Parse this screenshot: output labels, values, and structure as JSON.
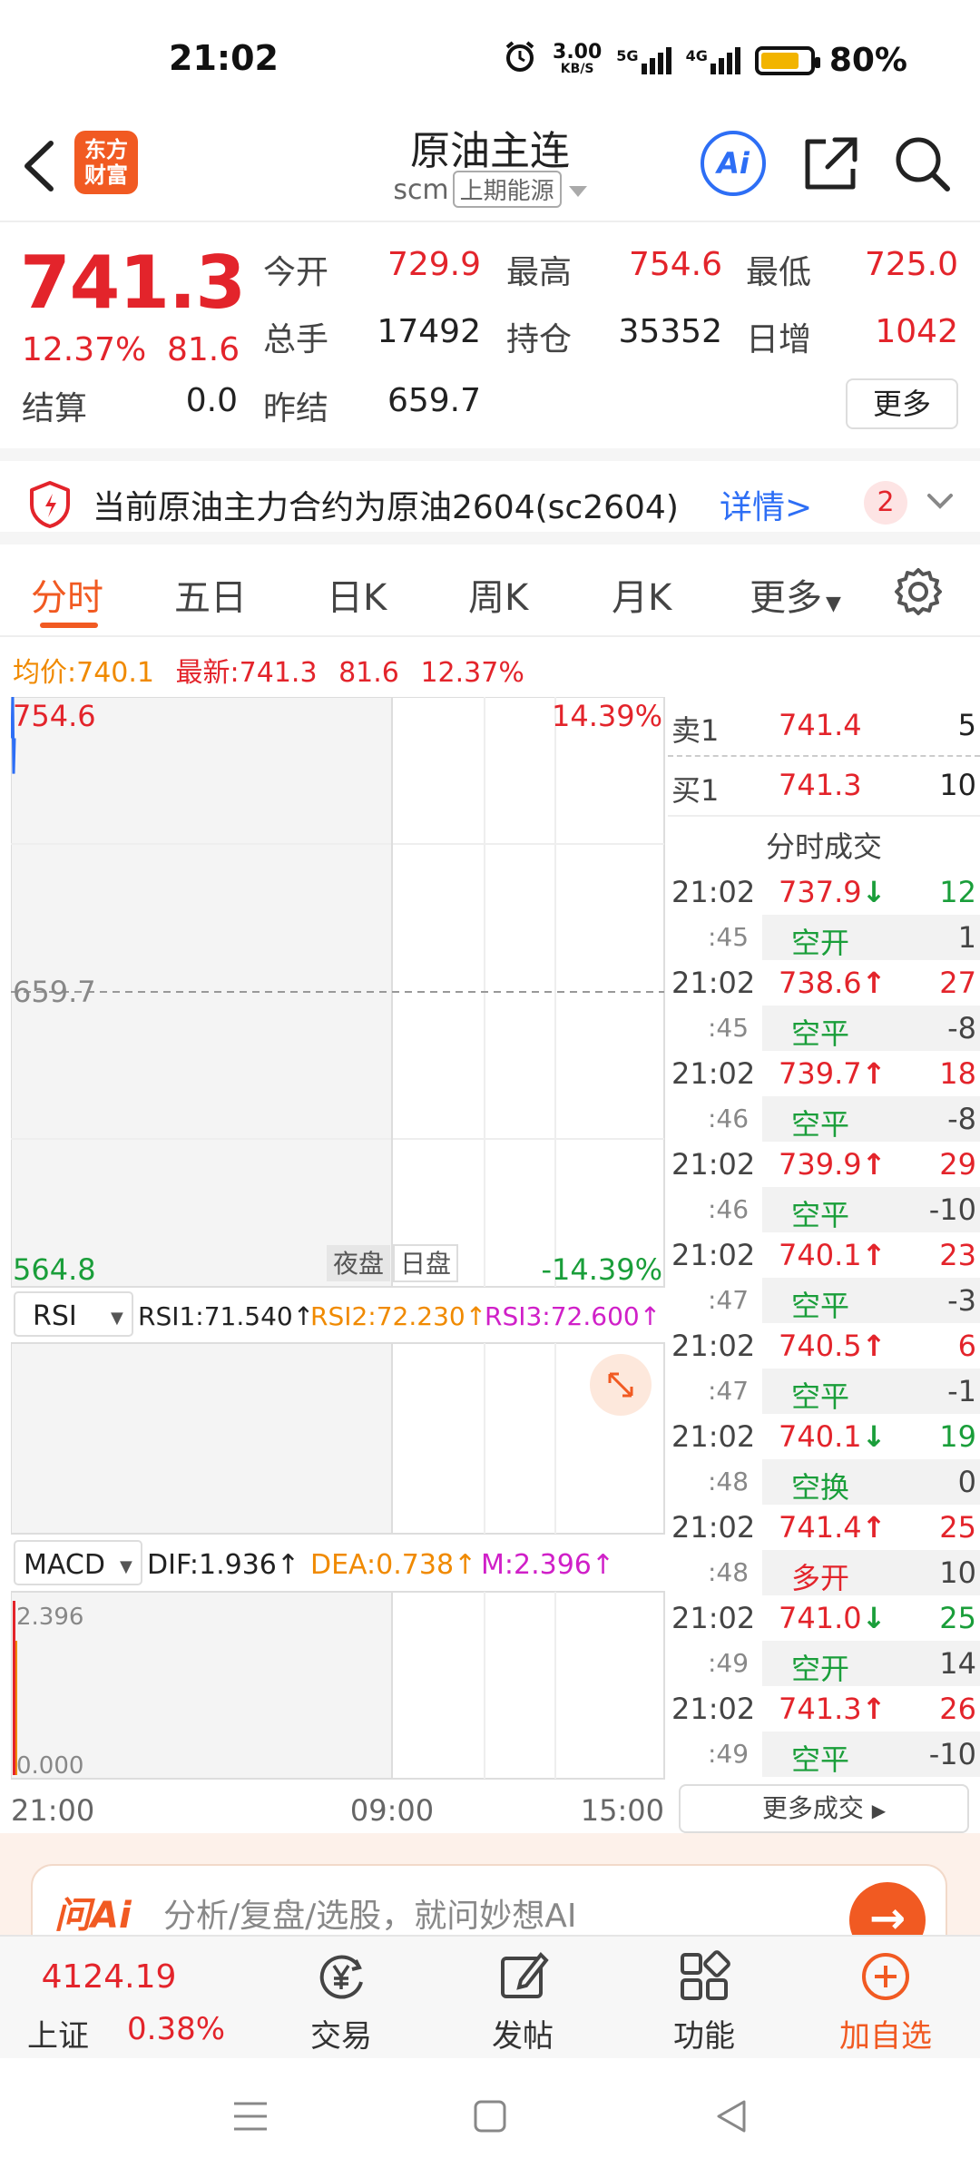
{
  "status": {
    "time": "21:02",
    "net_speed_value": "3.00",
    "net_speed_unit": "KB/S",
    "sig1_label": "5G",
    "sig2_label": "4G",
    "battery_text": "80%",
    "battery_level": 0.8
  },
  "header": {
    "logo_line1": "东方",
    "logo_line2": "财富",
    "title": "原油主连",
    "code": "scm",
    "exchange": "上期能源",
    "ai_label": "Ai"
  },
  "quote": {
    "last_price": "741.3",
    "change_pct": "12.37%",
    "change_val": "81.6",
    "labels": {
      "open": "今开",
      "high": "最高",
      "low": "最低",
      "volume": "总手",
      "open_interest": "持仓",
      "daily_inc": "日增",
      "settle": "结算",
      "prev_settle": "昨结"
    },
    "values": {
      "open": "729.9",
      "high": "754.6",
      "low": "725.0",
      "volume": "17492",
      "open_interest": "35352",
      "daily_inc": "1042",
      "settle": "0.0",
      "prev_settle": "659.7"
    },
    "more_label": "更多"
  },
  "notice": {
    "text": "当前原油主力合约为原油2604(sc2604)",
    "detail": "详情>",
    "badge": "2"
  },
  "tabs": [
    "分时",
    "五日",
    "日K",
    "周K",
    "月K",
    "更多"
  ],
  "avg_line": {
    "avg_label": "均价:",
    "avg_value": "740.1",
    "latest_label": "最新:",
    "latest_value": "741.3",
    "change": "81.6",
    "pct": "12.37%"
  },
  "chart": {
    "price_high": "754.6",
    "pct_high": "14.39%",
    "price_mid": "659.7",
    "price_low": "564.8",
    "pct_low": "-14.39%",
    "session_night": "夜盘",
    "session_day": "日盘",
    "rsi_selector": "RSI",
    "rsi1": "RSI1:71.540↑",
    "rsi2": "RSI2:72.230↑",
    "rsi3": "RSI3:72.600↑",
    "macd_selector": "MACD",
    "dif": "DIF:1.936↑",
    "dea": "DEA:0.738↑",
    "m": "M:2.396↑",
    "macd_top": "2.396",
    "macd_bottom": "0.000",
    "time_start": "21:00",
    "time_mid": "09:00",
    "time_end": "15:00",
    "colors": {
      "up": "#e3242b",
      "down": "#1a9e3a",
      "price_line": "#2d6ef5"
    }
  },
  "book": {
    "ask_label": "卖1",
    "ask_price": "741.4",
    "ask_qty": "5",
    "bid_label": "买1",
    "bid_price": "741.3",
    "bid_qty": "10",
    "ticks_title": "分时成交",
    "more_ticks": "更多成交"
  },
  "ticks": [
    {
      "time": "21:02",
      "price": "737.9",
      "dir": "↓",
      "qty": "12",
      "sec": ":45",
      "type": "空开",
      "chg": "1"
    },
    {
      "time": "21:02",
      "price": "738.6",
      "dir": "↑",
      "qty": "27",
      "sec": ":45",
      "type": "空平",
      "chg": "-8"
    },
    {
      "time": "21:02",
      "price": "739.7",
      "dir": "↑",
      "qty": "18",
      "sec": ":46",
      "type": "空平",
      "chg": "-8"
    },
    {
      "time": "21:02",
      "price": "739.9",
      "dir": "↑",
      "qty": "29",
      "sec": ":46",
      "type": "空平",
      "chg": "-10"
    },
    {
      "time": "21:02",
      "price": "740.1",
      "dir": "↑",
      "qty": "23",
      "sec": ":47",
      "type": "空平",
      "chg": "-3"
    },
    {
      "time": "21:02",
      "price": "740.5",
      "dir": "↑",
      "qty": "6",
      "sec": ":47",
      "type": "空平",
      "chg": "-1"
    },
    {
      "time": "21:02",
      "price": "740.1",
      "dir": "↓",
      "qty": "19",
      "sec": ":48",
      "type": "空换",
      "chg": "0"
    },
    {
      "time": "21:02",
      "price": "741.4",
      "dir": "↑",
      "qty": "25",
      "sec": ":48",
      "type": "多开",
      "chg": "10"
    },
    {
      "time": "21:02",
      "price": "741.0",
      "dir": "↓",
      "qty": "25",
      "sec": ":49",
      "type": "空开",
      "chg": "14"
    },
    {
      "time": "21:02",
      "price": "741.3",
      "dir": "↑",
      "qty": "26",
      "sec": ":49",
      "type": "空平",
      "chg": "-10"
    }
  ],
  "ai_bar": {
    "logo": "问Ai",
    "placeholder": "分析/复盘/选股，就问妙想AI"
  },
  "bottom_nav": {
    "index_value": "4124.19",
    "index_name": "上证",
    "index_pct": "0.38%",
    "trade": "交易",
    "post": "发帖",
    "functions": "功能",
    "add_watch": "加自选"
  }
}
